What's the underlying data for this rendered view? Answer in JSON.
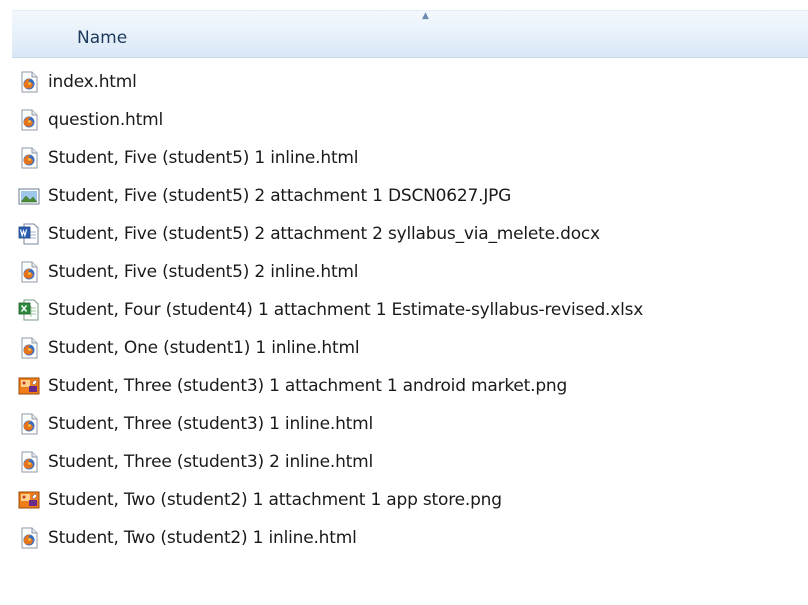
{
  "header": {
    "name_label": "Name"
  },
  "files": [
    {
      "name": "index.html",
      "icon": "firefox-html-file-icon"
    },
    {
      "name": "question.html",
      "icon": "firefox-html-file-icon"
    },
    {
      "name": "Student, Five (student5) 1  inline.html",
      "icon": "firefox-html-file-icon"
    },
    {
      "name": "Student, Five (student5) 2  attachment 1 DSCN0627.JPG",
      "icon": "image-file-icon"
    },
    {
      "name": "Student, Five (student5) 2  attachment 2 syllabus_via_melete.docx",
      "icon": "word-document-icon"
    },
    {
      "name": "Student, Five (student5) 2  inline.html",
      "icon": "firefox-html-file-icon"
    },
    {
      "name": "Student, Four (student4) 1  attachment 1 Estimate-syllabus-revised.xlsx",
      "icon": "excel-spreadsheet-icon"
    },
    {
      "name": "Student, One (student1) 1  inline.html",
      "icon": "firefox-html-file-icon"
    },
    {
      "name": "Student, Three (student3) 1  attachment 1 android market.png",
      "icon": "png-image-icon"
    },
    {
      "name": "Student, Three (student3) 1  inline.html",
      "icon": "firefox-html-file-icon"
    },
    {
      "name": "Student, Three (student3) 2  inline.html",
      "icon": "firefox-html-file-icon"
    },
    {
      "name": "Student, Two (student2) 1  attachment 1 app store.png",
      "icon": "png-image-icon"
    },
    {
      "name": "Student, Two (student2) 1  inline.html",
      "icon": "firefox-html-file-icon"
    }
  ]
}
